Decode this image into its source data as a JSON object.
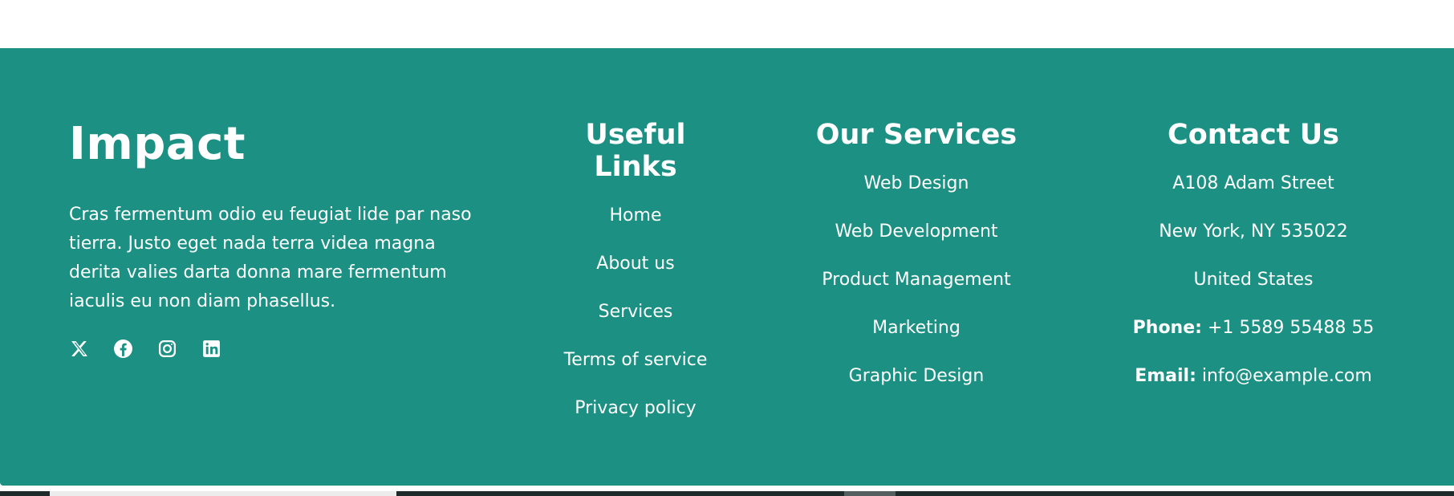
{
  "brand": {
    "title": "Impact",
    "description": "Cras fermentum odio eu feugiat lide par naso tierra. Justo eget nada terra videa magna derita valies darta donna mare fermentum iaculis eu non diam phasellus."
  },
  "socials": [
    {
      "icon": "x-twitter-icon"
    },
    {
      "icon": "facebook-icon"
    },
    {
      "icon": "instagram-icon"
    },
    {
      "icon": "linkedin-icon"
    }
  ],
  "useful_links": {
    "title": "Useful Links",
    "items": [
      "Home",
      "About us",
      "Services",
      "Terms of service",
      "Privacy policy"
    ]
  },
  "services": {
    "title": "Our Services",
    "items": [
      "Web Design",
      "Web Development",
      "Product Management",
      "Marketing",
      "Graphic Design"
    ]
  },
  "contact": {
    "title": "Contact Us",
    "address_line1": "A108 Adam Street",
    "address_line2": "New York, NY 535022",
    "country": "United States",
    "phone_label": "Phone:",
    "phone": "+1 5589 55488 55",
    "email_label": "Email:",
    "email": "info@example.com"
  },
  "colors": {
    "footer_background": "#1b9083",
    "text": "#ffffff"
  }
}
